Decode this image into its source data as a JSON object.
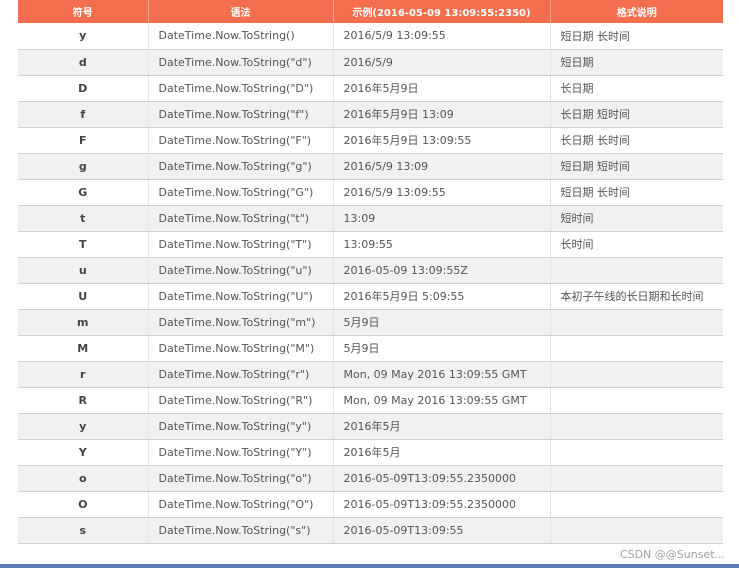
{
  "header": {
    "symbol": "符号",
    "syntax": "语法",
    "example": "示例(2016-05-09 13:09:55:2350)",
    "format": "格式说明"
  },
  "rows": [
    {
      "symbol": "y",
      "syntax": "DateTime.Now.ToString()",
      "example": "2016/5/9 13:09:55",
      "format": "短日期 长时间"
    },
    {
      "symbol": "d",
      "syntax": "DateTime.Now.ToString(\"d\")",
      "example": "2016/5/9",
      "format": "短日期"
    },
    {
      "symbol": "D",
      "syntax": "DateTime.Now.ToString(\"D\")",
      "example": "2016年5月9日",
      "format": "长日期"
    },
    {
      "symbol": "f",
      "syntax": "DateTime.Now.ToString(\"f\")",
      "example": "2016年5月9日 13:09",
      "format": "长日期 短时间"
    },
    {
      "symbol": "F",
      "syntax": "DateTime.Now.ToString(\"F\")",
      "example": "2016年5月9日 13:09:55",
      "format": "长日期 长时间"
    },
    {
      "symbol": "g",
      "syntax": "DateTime.Now.ToString(\"g\")",
      "example": "2016/5/9 13:09",
      "format": "短日期 短时间"
    },
    {
      "symbol": "G",
      "syntax": "DateTime.Now.ToString(\"G\")",
      "example": "2016/5/9 13:09:55",
      "format": "短日期 长时间"
    },
    {
      "symbol": "t",
      "syntax": "DateTime.Now.ToString(\"t\")",
      "example": "13:09",
      "format": "短时间"
    },
    {
      "symbol": "T",
      "syntax": "DateTime.Now.ToString(\"T\")",
      "example": "13:09:55",
      "format": "长时间"
    },
    {
      "symbol": "u",
      "syntax": "DateTime.Now.ToString(\"u\")",
      "example": "2016-05-09 13:09:55Z",
      "format": ""
    },
    {
      "symbol": "U",
      "syntax": "DateTime.Now.ToString(\"U\")",
      "example": "2016年5月9日 5:09:55",
      "format": "本初子午线的长日期和长时间"
    },
    {
      "symbol": "m",
      "syntax": "DateTime.Now.ToString(\"m\")",
      "example": "5月9日",
      "format": ""
    },
    {
      "symbol": "M",
      "syntax": "DateTime.Now.ToString(\"M\")",
      "example": "5月9日",
      "format": ""
    },
    {
      "symbol": "r",
      "syntax": "DateTime.Now.ToString(\"r\")",
      "example": "Mon, 09 May 2016 13:09:55 GMT",
      "format": ""
    },
    {
      "symbol": "R",
      "syntax": "DateTime.Now.ToString(\"R\")",
      "example": "Mon, 09 May 2016 13:09:55 GMT",
      "format": ""
    },
    {
      "symbol": "y",
      "syntax": "DateTime.Now.ToString(\"y\")",
      "example": "2016年5月",
      "format": ""
    },
    {
      "symbol": "Y",
      "syntax": "DateTime.Now.ToString(\"Y\")",
      "example": "2016年5月",
      "format": ""
    },
    {
      "symbol": "o",
      "syntax": "DateTime.Now.ToString(\"o\")",
      "example": "2016-05-09T13:09:55.2350000",
      "format": ""
    },
    {
      "symbol": "O",
      "syntax": "DateTime.Now.ToString(\"O\")",
      "example": "2016-05-09T13:09:55.2350000",
      "format": ""
    },
    {
      "symbol": "s",
      "syntax": "DateTime.Now.ToString(\"s\")",
      "example": "2016-05-09T13:09:55",
      "format": ""
    }
  ],
  "watermark": "CSDN @@Sunset...",
  "colors": {
    "header_bg": "#f26e4c",
    "row_alt_bg": "#f1f1f1",
    "bottom_bar": "#5b7fb5"
  }
}
